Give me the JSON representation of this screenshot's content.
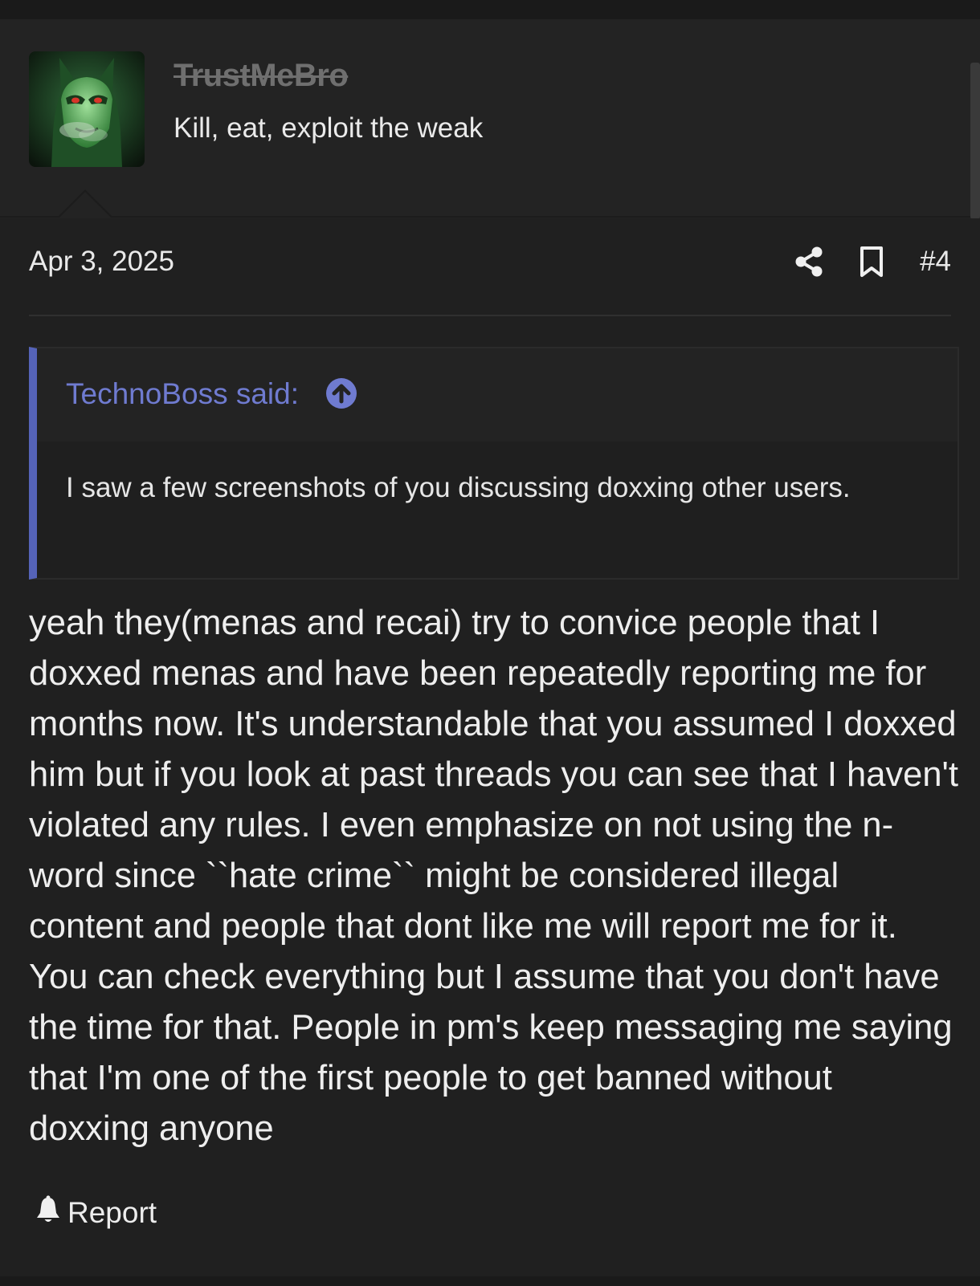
{
  "header": {
    "username": "TrustMeBro",
    "user_title": "Kill, eat, exploit the weak",
    "avatar_icon": "masked-green-hero-avatar"
  },
  "post": {
    "date": "Apr 3, 2025",
    "number": "#4",
    "share_icon": "share-icon",
    "bookmark_icon": "bookmark-icon",
    "quote": {
      "author": "TechnoBoss said:",
      "jump_icon": "arrow-up-circle-icon",
      "text": "I saw a few screenshots of you discussing doxxing other users."
    },
    "message": "yeah they(menas and recai) try to convice people that I doxxed menas and have been repeatedly reporting me for months now. It's understandable that you assumed I doxxed him but if you look at past threads you can see that I haven't violated any rules. I even emphasize on not using the n-word since ``hate crime`` might be considered illegal content and people that dont like me will report me for it. You can check everything but I assume that you don't have the time for that. People in pm's keep messaging me saying that I'm one of the first people to get banned without doxxing anyone",
    "report_label": "Report",
    "report_icon": "bell-icon"
  },
  "colors": {
    "background": "#202020",
    "quote_accent": "#5563b8",
    "quote_author": "#6f7bd0",
    "username_struck": "#6f6f6f"
  }
}
